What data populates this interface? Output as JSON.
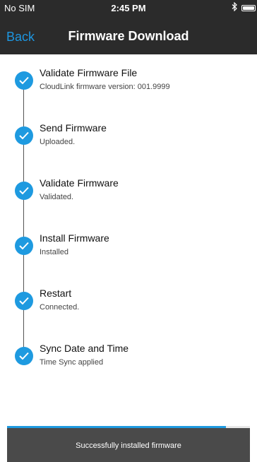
{
  "status_bar": {
    "carrier": "No SIM",
    "time": "2:45 PM",
    "bluetooth_icon": "bluetooth-icon",
    "battery_icon": "battery-icon"
  },
  "nav": {
    "back_label": "Back",
    "title": "Firmware Download"
  },
  "colors": {
    "header_bg": "#2b2b2b",
    "accent": "#1e9ae0",
    "toast_bg": "#4a4a4a"
  },
  "steps": [
    {
      "title": "Validate Firmware File",
      "subtitle": "CloudLink firmware version: 001.9999",
      "status": "complete",
      "icon": "checkmark-icon"
    },
    {
      "title": "Send Firmware",
      "subtitle": "Uploaded.",
      "status": "complete",
      "icon": "checkmark-icon"
    },
    {
      "title": "Validate Firmware",
      "subtitle": "Validated.",
      "status": "complete",
      "icon": "checkmark-icon"
    },
    {
      "title": "Install Firmware",
      "subtitle": "Installed",
      "status": "complete",
      "icon": "checkmark-icon"
    },
    {
      "title": "Restart",
      "subtitle": "Connected.",
      "status": "complete",
      "icon": "checkmark-icon"
    },
    {
      "title": "Sync Date and Time",
      "subtitle": "Time Sync applied",
      "status": "complete",
      "icon": "checkmark-icon"
    }
  ],
  "toast": {
    "message": "Successfully installed firmware",
    "progress_fraction": 0.9
  }
}
